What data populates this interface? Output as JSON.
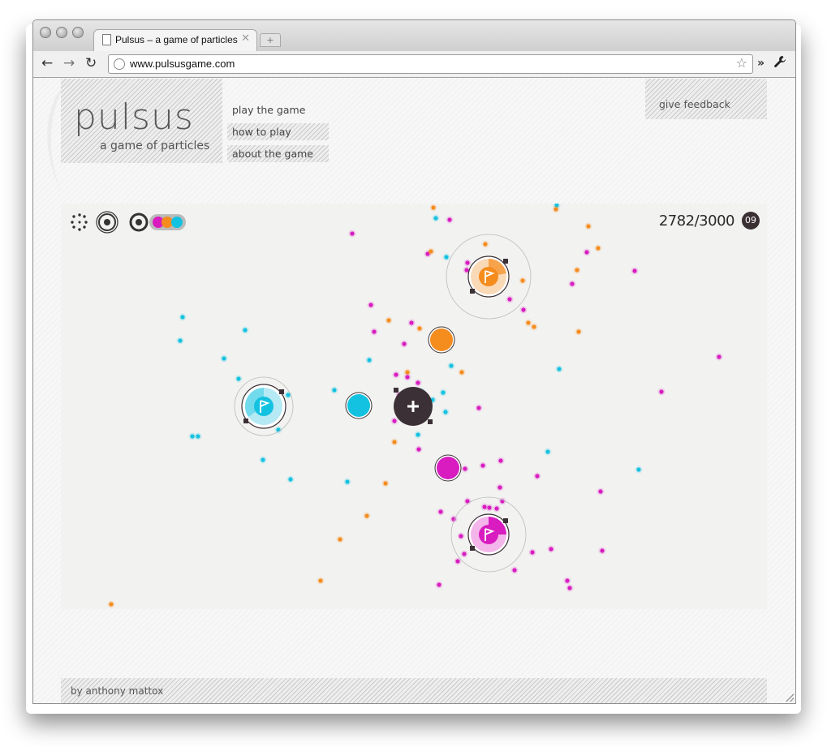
{
  "browser": {
    "tab_title": "Pulsus – a game of particles",
    "tab_close": "✕",
    "new_tab": "+",
    "url": "www.pulsusgame.com",
    "back": "←",
    "forward": "→",
    "reload": "↻",
    "bookmark_star": "☆",
    "overflow": "»",
    "wrench": "🔧"
  },
  "site": {
    "logo_name": "pulsus",
    "logo_tagline": "a game of particles",
    "nav": [
      "play the game",
      "how to play",
      "about the game"
    ],
    "feedback": "give feedback",
    "footer": "by anthony mattox"
  },
  "game": {
    "score": "2782/3000",
    "level": "09",
    "colors": {
      "magenta": "#d81cc0",
      "orange": "#f58c1e",
      "cyan": "#13c2e0",
      "dark": "#3b3035"
    },
    "hud_icons": [
      "particles-icon",
      "pulse-icon",
      "target-icon",
      "color-sequence-icon"
    ],
    "flags": [
      {
        "color": "cyan",
        "icon": "flag-icon"
      },
      {
        "color": "orange",
        "icon": "flag-icon"
      },
      {
        "color": "magenta",
        "icon": "flag-icon"
      }
    ],
    "player_icon": "plus-icon"
  }
}
